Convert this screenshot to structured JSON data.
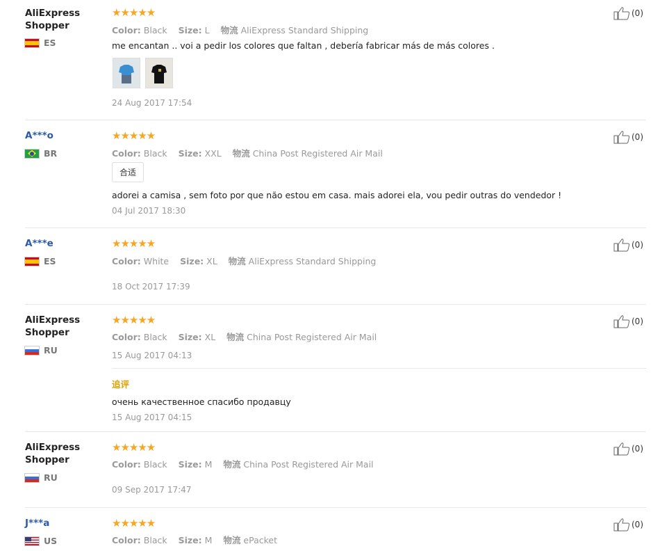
{
  "labels": {
    "color": "Color:",
    "size": "Size:",
    "shipping": "物流"
  },
  "reviews": [
    {
      "user": "AliExpress Shopper",
      "country": "ES",
      "stars": "★★★★★",
      "color": "Black",
      "size": "L",
      "shipping": "AliExpress Standard Shipping",
      "text": "me encantan .. voi a pedir los colores que faltan , debería fabricar más de más colores .",
      "date": "24 Aug 2017 17:54",
      "likes": "(0)"
    },
    {
      "user": "A***o",
      "country": "BR",
      "stars": "★★★★★",
      "color": "Black",
      "size": "XXL",
      "shipping": "China Post Registered Air Mail",
      "tag": "合适",
      "text": "adorei a camisa , sem foto por que não estou em casa. mais adorei ela, vou pedir outras do vendedor !",
      "date": "04 Jul 2017 18:30",
      "likes": "(0)"
    },
    {
      "user": "A***e",
      "country": "ES",
      "stars": "★★★★★",
      "color": "White",
      "size": "XL",
      "shipping": "AliExpress Standard Shipping",
      "date": "18 Oct 2017 17:39",
      "likes": "(0)"
    },
    {
      "user": "AliExpress Shopper",
      "country": "RU",
      "stars": "★★★★★",
      "color": "Black",
      "size": "XL",
      "shipping": "China Post Registered Air Mail",
      "date": "15 Aug 2017 04:13",
      "additional_label": "追评",
      "additional_text": "очень качественное спасибо продавцу",
      "additional_date": "15 Aug 2017 04:15",
      "likes": "(0)"
    },
    {
      "user": "AliExpress Shopper",
      "country": "RU",
      "stars": "★★★★★",
      "color": "Black",
      "size": "M",
      "shipping": "China Post Registered Air Mail",
      "date": "09 Sep 2017 17:47",
      "likes": "(0)"
    },
    {
      "user": "J***a",
      "country": "US",
      "stars": "★★★★★",
      "color": "Black",
      "size": "M",
      "shipping": "ePacket",
      "likes": "(0)"
    }
  ]
}
